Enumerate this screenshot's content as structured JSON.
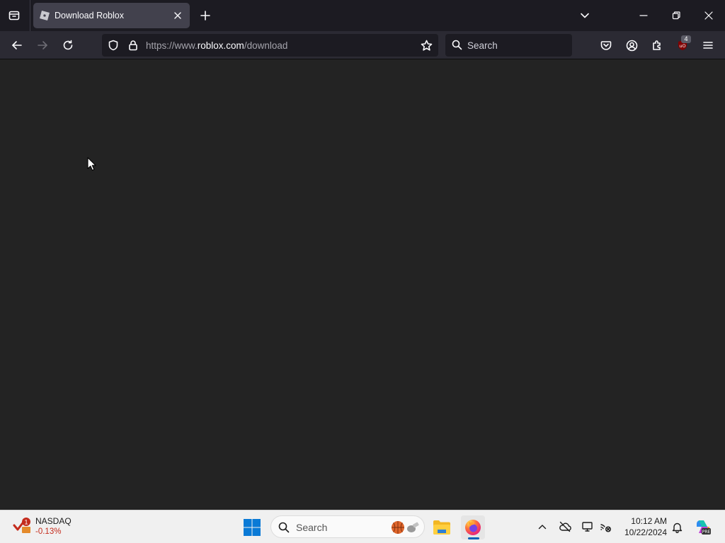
{
  "browser": {
    "tab": {
      "title": "Download Roblox",
      "favicon": "roblox-icon"
    },
    "url": {
      "prefix": "https://www.",
      "domain": "roblox.com",
      "path": "/download"
    },
    "search_placeholder": "Search",
    "extension_badge": "4",
    "colors": {
      "tabstrip": "#1c1b22",
      "active_tab": "#42414d",
      "toolbar": "#2b2a33",
      "content": "#232323"
    }
  },
  "taskbar": {
    "widget": {
      "name": "NASDAQ",
      "change": "-0.13%",
      "badge": "1"
    },
    "search_placeholder": "Search",
    "apps": [
      "windows-start-icon",
      "file-explorer-icon",
      "firefox-icon"
    ],
    "clock": {
      "time": "10:12 AM",
      "date": "10/22/2024"
    }
  }
}
